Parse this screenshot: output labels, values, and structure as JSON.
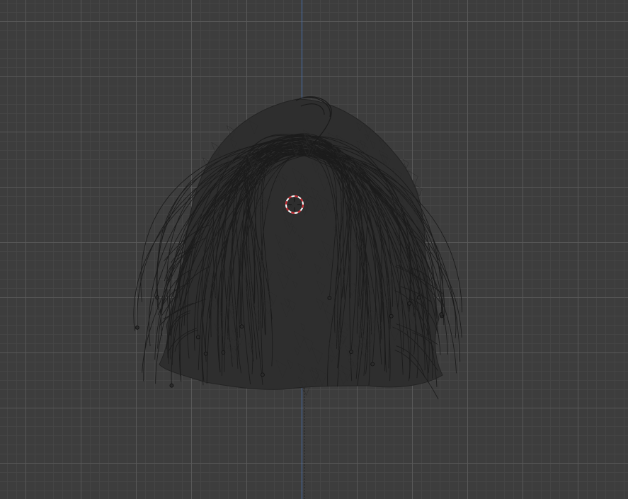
{
  "viewport": {
    "mode": "wireframe",
    "background_color": "#3d3d3d",
    "grid_major_color": "#5a5a5a",
    "grid_minor_color": "#464646",
    "axis_color": "#4a6fa8",
    "mesh_color": "#1e1e1e"
  },
  "object": {
    "type": "hair-mesh"
  },
  "cursor": {
    "icon": "3d-cursor-icon",
    "colors": [
      "#c8232a",
      "#ffffff"
    ]
  }
}
